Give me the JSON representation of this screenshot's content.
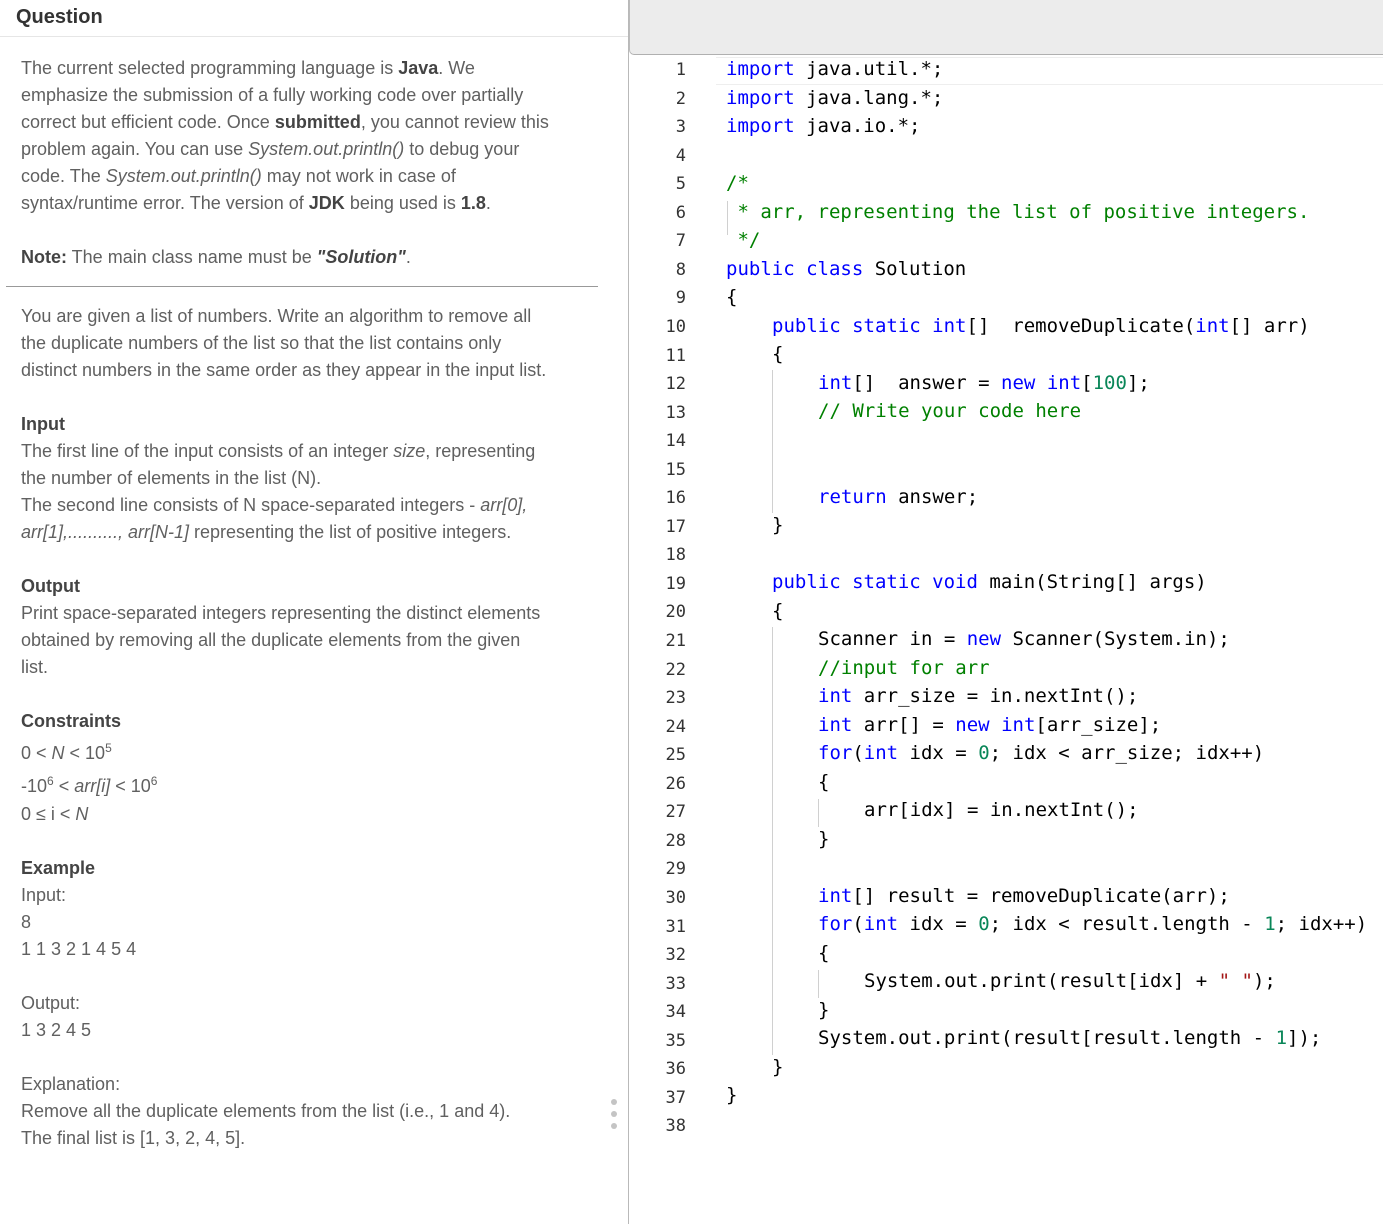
{
  "question_panel": {
    "heading": "Question",
    "intro": {
      "l1a": "The current selected programming language is ",
      "l1b": "Java",
      "l1c": ". We",
      "l2": "emphasize the submission of a fully working code over partially",
      "l3a": "correct but efficient code. Once ",
      "l3b": "submitted",
      "l3c": ", you cannot review this",
      "l4a": "problem again. You can use ",
      "l4b": "System.out.println()",
      "l4c": " to debug your",
      "l5a": "code. The ",
      "l5b": "System.out.println()",
      "l5c": " may not work in case of",
      "l6a": "syntax/runtime error. The version of ",
      "l6b": "JDK",
      "l6c": " being used is ",
      "l6d": "1.8",
      "l6e": "."
    },
    "note": {
      "label": "Note:",
      "text": " The main class name must be ",
      "value": "\"Solution\"",
      "end": "."
    },
    "description": [
      "You are given a list of numbers. Write an algorithm to remove all",
      "the duplicate numbers of the list so that the list contains only",
      "distinct numbers in the same order as they appear in the input list."
    ],
    "input": {
      "heading": "Input",
      "l1a": "The first line of the input consists of an integer ",
      "l1b": "size",
      "l1c": ", representing",
      "l2": "the number of elements in the list (N).",
      "l3a": "The second line consists of N space-separated integers - ",
      "l3b": "arr[0],",
      "l4a": "arr[1],.........., arr[N-1]",
      "l4b": " representing the list of positive integers."
    },
    "output": {
      "heading": "Output",
      "lines": [
        "Print space-separated integers representing the distinct elements",
        "obtained by removing all the duplicate elements from the given",
        "list."
      ]
    },
    "constraints": {
      "heading": "Constraints",
      "c1a": "0 < ",
      "c1b": "N",
      "c1c": " < 10",
      "c1d": "5",
      "c2a": "-10",
      "c2b": "6",
      "c2c": " < ",
      "c2d": "arr[i]",
      "c2e": " < 10",
      "c2f": "6",
      "c3a": "0 ≤ i < ",
      "c3b": "N"
    },
    "example": {
      "heading": "Example",
      "input_label": "Input:",
      "input_size": "8",
      "input_values": "1 1 3 2 1 4 5 4",
      "output_label": "Output:",
      "output_values": "1 3 2 4 5",
      "explanation_label": "Explanation:",
      "explanation": [
        "Remove all the duplicate elements from the list (i.e., 1 and 4).",
        "The final list is [1, 3, 2, 4, 5]."
      ]
    }
  },
  "editor": {
    "line_numbers": [
      "1",
      "2",
      "3",
      "4",
      "5",
      "6",
      "7",
      "8",
      "9",
      "10",
      "11",
      "12",
      "13",
      "14",
      "15",
      "16",
      "17",
      "18",
      "19",
      "20",
      "21",
      "22",
      "23",
      "24",
      "25",
      "26",
      "27",
      "28",
      "29",
      "30",
      "31",
      "32",
      "33",
      "34",
      "35",
      "36",
      "37",
      "38"
    ],
    "tokens": {
      "import": "import",
      "pkg_util": " java.util.*;",
      "pkg_lang": " java.lang.*;",
      "pkg_io": " java.io.*;",
      "c_open": "/*",
      "c_body": " * arr, representing the list of positive integers.",
      "c_close": " */",
      "public": "public",
      "class": " class",
      "solution": " Solution",
      "lbrace": "{",
      "rbrace": "}",
      "static": " static",
      "int": "int",
      "arr_sig_a": "[]  removeDuplicate(",
      "arr_sig_b": "[] arr)",
      "answer_a": "[]  answer = ",
      "new": "new",
      "int100_a": "[",
      "n100": "100",
      "int100_b": "];",
      "write_here": "// Write your code here",
      "return": "return",
      "return_rest": " answer;",
      "void": "void",
      "main_sig": " main(String[] args)",
      "scanner_a": "Scanner in = ",
      "scanner_b": " Scanner(System.in);",
      "input_comment": "//input for arr",
      "arrsize_rest": " arr_size = in.nextInt();",
      "arrdecl_a": " arr[] = ",
      "arrdecl_b": "[arr_size];",
      "for": "for",
      "paren": "(",
      "idx_init": " idx = ",
      "zero": "0",
      "loop1_rest": "; idx < arr_size; idx++)",
      "read_stmt": "arr[idx] = in.nextInt();",
      "result_rest": "[] result = removeDuplicate(arr);",
      "loop2_a": "; idx < result.length - ",
      "one": "1",
      "loop2_b": "; idx++)",
      "print_a": "System.out.print(result[idx] + ",
      "space_str": "\" \"",
      "print_b": ");",
      "print2_a": "System.out.print(result[result.length - ",
      "print2_b": "]);"
    }
  },
  "colors": {
    "keyword": "#0000ff",
    "comment": "#008000",
    "number": "#098658",
    "string": "#a31515"
  }
}
